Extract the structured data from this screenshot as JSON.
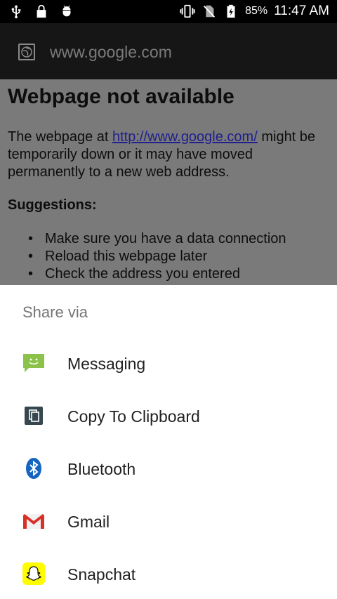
{
  "status_bar": {
    "left_icons": [
      "usb-icon",
      "lock-icon",
      "android-debug-icon"
    ],
    "right_icons": [
      "vibrate-icon",
      "no-sim-icon",
      "battery-charging-icon"
    ],
    "battery": "85%",
    "time": "11:47 AM"
  },
  "url_bar": {
    "icon": "globe-icon",
    "url": "www.google.com"
  },
  "webpage": {
    "title": "Webpage not available",
    "para_before": "The webpage at ",
    "link": "http://www.google.com/",
    "para_after": " might be temporarily down or it may have moved permanently to a new web address.",
    "suggestions_heading": "Suggestions:",
    "suggestions": [
      "Make sure you have a data connection",
      "Reload this webpage later",
      "Check the address you entered"
    ]
  },
  "share_sheet": {
    "title": "Share via",
    "items": [
      {
        "label": "Messaging",
        "icon": "messaging-icon"
      },
      {
        "label": "Copy To Clipboard",
        "icon": "clipboard-icon"
      },
      {
        "label": "Bluetooth",
        "icon": "bluetooth-icon"
      },
      {
        "label": "Gmail",
        "icon": "gmail-icon"
      },
      {
        "label": "Snapchat",
        "icon": "snapchat-icon"
      }
    ]
  },
  "colors": {
    "messaging": "#8bc34a",
    "clipboard": "#37474f",
    "bluetooth": "#1565c0",
    "gmail": "#d93025",
    "snapchat": "#fffc00"
  }
}
